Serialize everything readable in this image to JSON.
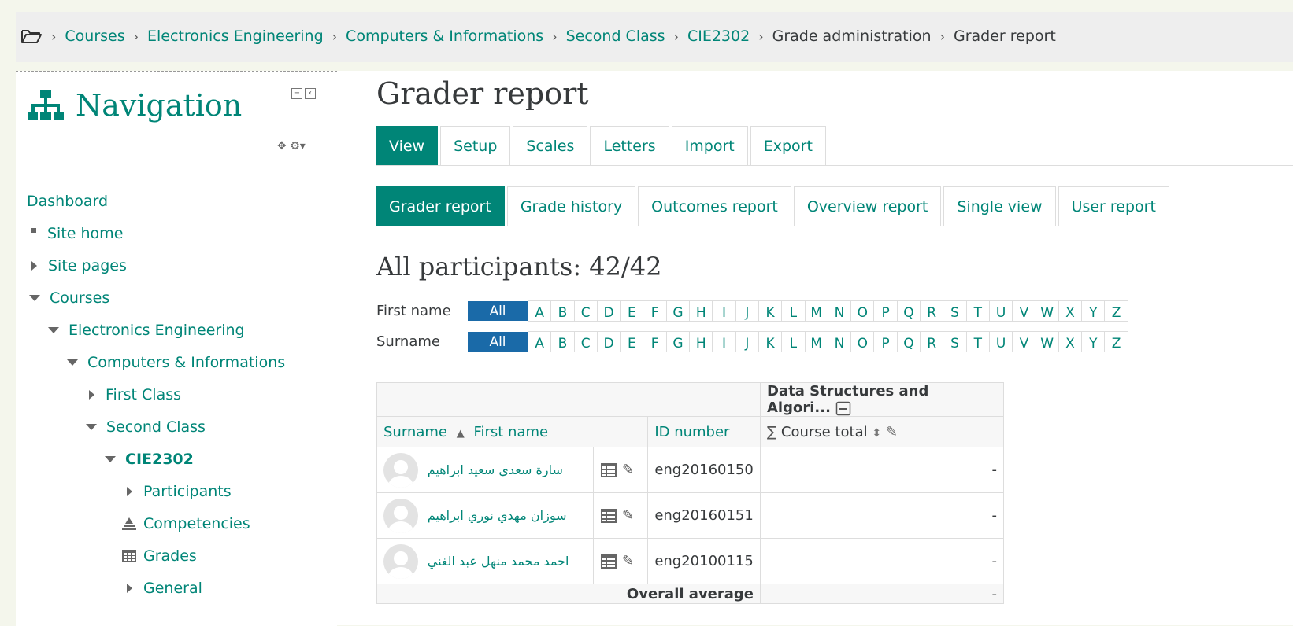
{
  "breadcrumb": {
    "items": [
      "Courses",
      "Electronics Engineering",
      "Computers & Informations",
      "Second Class",
      "CIE2302",
      "Grade administration",
      "Grader report"
    ]
  },
  "navigation": {
    "title": "Navigation",
    "dashboard": "Dashboard",
    "site_home": "Site home",
    "site_pages": "Site pages",
    "courses": "Courses",
    "electronics": "Electronics Engineering",
    "computers": "Computers & Informations",
    "first_class": "First Class",
    "second_class": "Second Class",
    "course": "CIE2302",
    "participants": "Participants",
    "competencies": "Competencies",
    "grades": "Grades",
    "general": "General"
  },
  "page": {
    "title": "Grader report"
  },
  "tabs_primary": [
    "View",
    "Setup",
    "Scales",
    "Letters",
    "Import",
    "Export"
  ],
  "tabs_secondary": [
    "Grader report",
    "Grade history",
    "Outcomes report",
    "Overview report",
    "Single view",
    "User report"
  ],
  "participants_heading": "All participants: 42/42",
  "initials": {
    "first_name_label": "First name",
    "surname_label": "Surname",
    "all_label": "All",
    "letters": [
      "A",
      "B",
      "C",
      "D",
      "E",
      "F",
      "G",
      "H",
      "I",
      "J",
      "K",
      "L",
      "M",
      "N",
      "O",
      "P",
      "Q",
      "R",
      "S",
      "T",
      "U",
      "V",
      "W",
      "X",
      "Y",
      "Z"
    ]
  },
  "grader_table": {
    "category_header": "Data Structures and Algori...",
    "surname_header": "Surname",
    "firstname_header": "First name",
    "id_header": "ID number",
    "course_total_header": "Course total",
    "rows": [
      {
        "name": "سارة سعدي سعيد ابراهيم",
        "id": "eng20160150",
        "total": "-"
      },
      {
        "name": "سوزان مهدي نوري ابراهيم",
        "id": "eng20160151",
        "total": "-"
      },
      {
        "name": "احمد محمد منهل عبد الغني",
        "id": "eng20100115",
        "total": "-"
      }
    ],
    "overall_label": "Overall average",
    "overall_value": "-"
  }
}
